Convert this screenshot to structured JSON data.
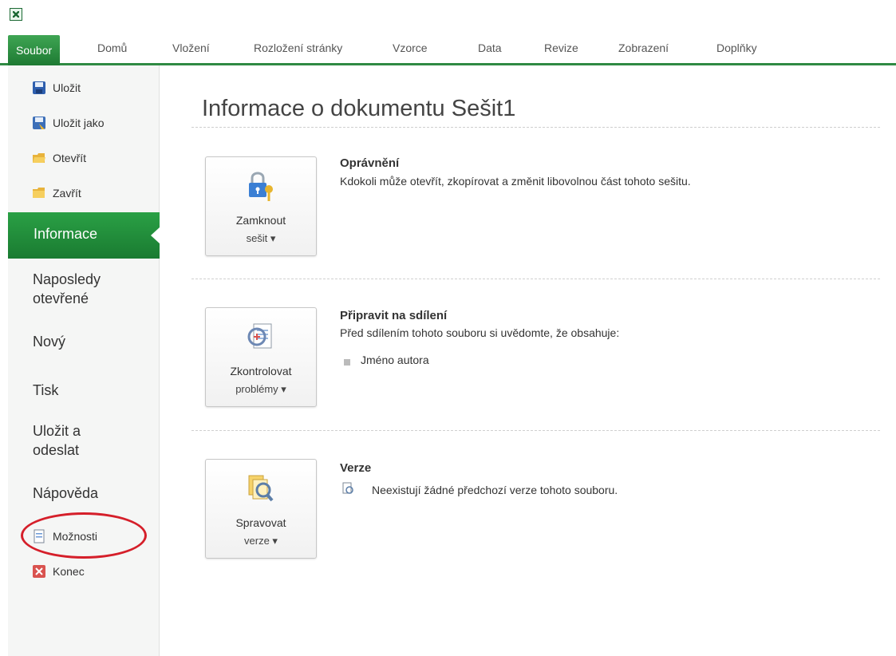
{
  "tabs": [
    {
      "label": "Soubor",
      "active": true
    },
    {
      "label": "Domů"
    },
    {
      "label": "Vložení"
    },
    {
      "label": "Rozložení stránky"
    },
    {
      "label": "Vzorce"
    },
    {
      "label": "Data"
    },
    {
      "label": "Revize"
    },
    {
      "label": "Zobrazení"
    },
    {
      "label": "Doplňky"
    }
  ],
  "sidebar": {
    "small_items": [
      {
        "label": "Uložit",
        "icon": "save-icon"
      },
      {
        "label": "Uložit jako",
        "icon": "save-as-icon"
      },
      {
        "label": "Otevřít",
        "icon": "open-folder-icon"
      },
      {
        "label": "Zavřít",
        "icon": "close-folder-icon"
      }
    ],
    "active_item": "Informace",
    "big_items": [
      "Naposledy otevřené",
      "Nový",
      "Tisk",
      "Uložit a odeslat",
      "Nápověda"
    ],
    "options": "Možnosti",
    "exit": "Konec"
  },
  "main": {
    "title": "Informace o dokumentu Sešit1",
    "sections": [
      {
        "button_l1": "Zamknout",
        "button_l2": "sešit ▾",
        "title": "Oprávnění",
        "text": "Kdokoli může otevřít, zkopírovat a změnit libovolnou část tohoto sešitu."
      },
      {
        "button_l1": "Zkontrolovat",
        "button_l2": "problémy ▾",
        "title": "Připravit na sdílení",
        "text": "Před sdílením tohoto souboru si uvědomte, že obsahuje:",
        "bullet": "Jméno autora"
      },
      {
        "button_l1": "Spravovat",
        "button_l2": "verze ▾",
        "title": "Verze",
        "text": "Neexistují žádné předchozí verze tohoto souboru."
      }
    ]
  },
  "colors": {
    "accent_green": "#1e7a33",
    "highlight_red": "#d51f2a"
  }
}
